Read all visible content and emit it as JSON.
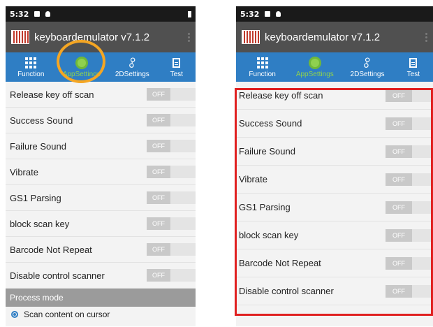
{
  "status": {
    "time": "5:32"
  },
  "app": {
    "title": "keyboardemulator v7.1.2"
  },
  "tabs": [
    {
      "label": "Function",
      "icon": "grid-icon"
    },
    {
      "label": "AppSettings",
      "icon": "gear-icon"
    },
    {
      "label": "2DSettings",
      "icon": "link-icon"
    },
    {
      "label": "Test",
      "icon": "clipboard-icon"
    }
  ],
  "active_tab": "AppSettings",
  "settings": [
    {
      "label": "Release key off scan",
      "state": "OFF"
    },
    {
      "label": "Success Sound",
      "state": "OFF"
    },
    {
      "label": "Failure Sound",
      "state": "OFF"
    },
    {
      "label": "Vibrate",
      "state": "OFF"
    },
    {
      "label": "GS1 Parsing",
      "state": "OFF"
    },
    {
      "label": "block scan key",
      "state": "OFF"
    },
    {
      "label": "Barcode Not Repeat",
      "state": "OFF"
    },
    {
      "label": "Disable control scanner",
      "state": "OFF"
    }
  ],
  "process_mode": {
    "header": "Process mode",
    "option": "Scan content on cursor"
  },
  "colors": {
    "tab_bar": "#2f7ec4",
    "active_tab_label": "#8fd14f",
    "callout_circle": "#f5a623",
    "callout_rect": "#e02020"
  }
}
